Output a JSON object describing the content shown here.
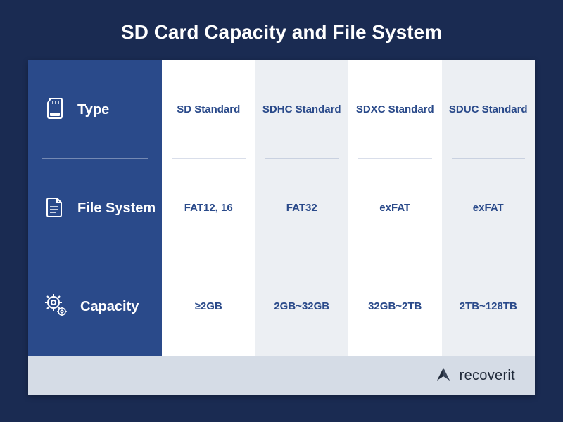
{
  "title": "SD Card Capacity and File System",
  "rows": [
    {
      "icon": "sd-card-icon",
      "label": "Type"
    },
    {
      "icon": "file-icon",
      "label": "File System"
    },
    {
      "icon": "gear-icon",
      "label": "Capacity"
    }
  ],
  "columns": [
    "SD Standard",
    "SDHC Standard",
    "SDXC Standard",
    "SDUC Standard"
  ],
  "cells": {
    "type": [
      "SD Standard",
      "SDHC Standard",
      "SDXC Standard",
      "SDUC Standard"
    ],
    "filesystem": [
      "FAT12, 16",
      "FAT32",
      "exFAT",
      "exFAT"
    ],
    "capacity": [
      "≥2GB",
      "2GB~32GB",
      "32GB~2TB",
      "2TB~128TB"
    ]
  },
  "brand": "recoverit",
  "colors": {
    "bg": "#1a2b52",
    "header": "#2a4a8a",
    "text": "#2a4a8a",
    "footer": "#d5dce6"
  },
  "chart_data": {
    "type": "table",
    "title": "SD Card Capacity and File System",
    "row_headers": [
      "Type",
      "File System",
      "Capacity"
    ],
    "columns": [
      "SD Standard",
      "SDHC Standard",
      "SDXC Standard",
      "SDUC Standard"
    ],
    "rows": [
      [
        "SD Standard",
        "SDHC Standard",
        "SDXC Standard",
        "SDUC Standard"
      ],
      [
        "FAT12, 16",
        "FAT32",
        "exFAT",
        "exFAT"
      ],
      [
        "≥2GB",
        "2GB~32GB",
        "32GB~2TB",
        "2TB~128TB"
      ]
    ]
  }
}
